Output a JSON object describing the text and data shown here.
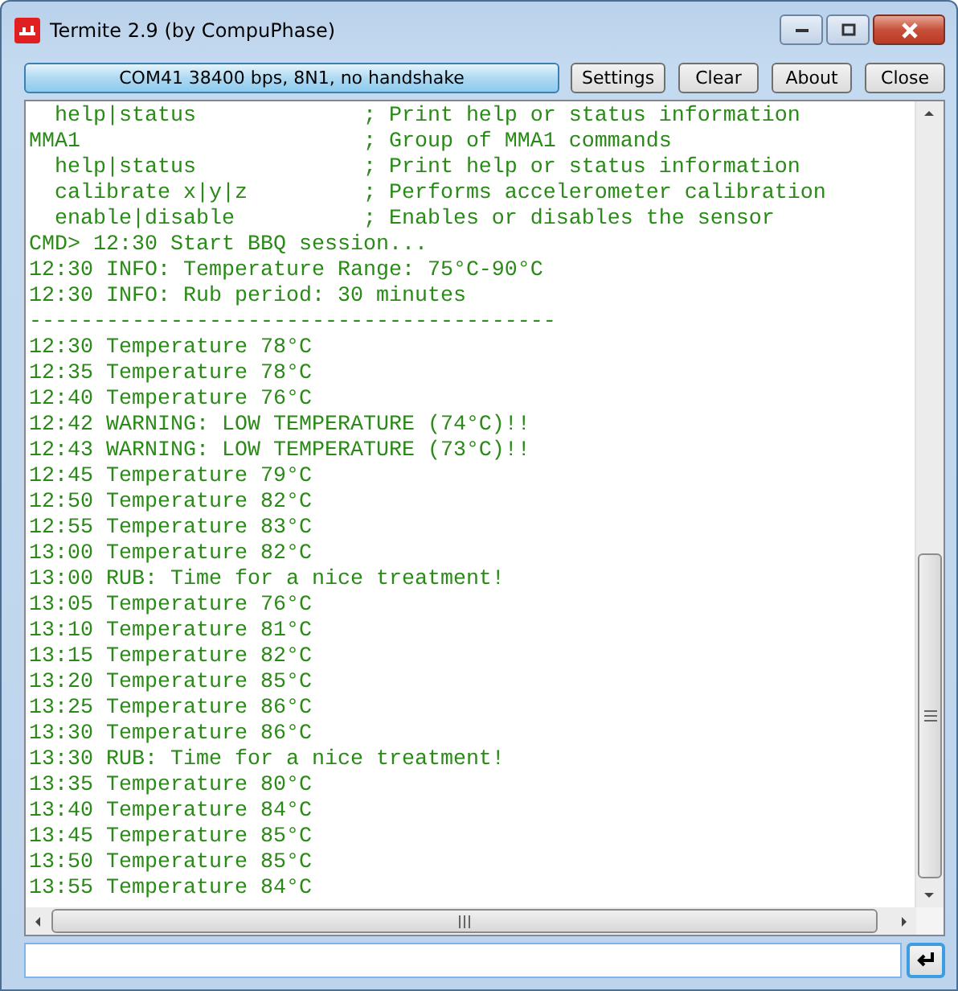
{
  "window": {
    "title": "Termite 2.9 (by CompuPhase)"
  },
  "toolbar": {
    "status": "COM41 38400 bps, 8N1, no handshake",
    "buttons": [
      "Settings",
      "Clear",
      "About",
      "Close"
    ]
  },
  "terminal": {
    "lines": [
      "  help|status             ; Print help or status information",
      "MMA1                      ; Group of MMA1 commands",
      "  help|status             ; Print help or status information",
      "  calibrate x|y|z         ; Performs accelerometer calibration",
      "  enable|disable          ; Enables or disables the sensor",
      "CMD> 12:30 Start BBQ session...",
      "12:30 INFO: Temperature Range: 75°C-90°C",
      "12:30 INFO: Rub period: 30 minutes",
      "-----------------------------------------",
      "12:30 Temperature 78°C",
      "12:35 Temperature 78°C",
      "12:40 Temperature 76°C",
      "12:42 WARNING: LOW TEMPERATURE (74°C)!!",
      "12:43 WARNING: LOW TEMPERATURE (73°C)!!",
      "12:45 Temperature 79°C",
      "12:50 Temperature 82°C",
      "12:55 Temperature 83°C",
      "13:00 Temperature 82°C",
      "13:00 RUB: Time for a nice treatment!",
      "13:05 Temperature 76°C",
      "13:10 Temperature 81°C",
      "13:15 Temperature 82°C",
      "13:20 Temperature 85°C",
      "13:25 Temperature 86°C",
      "13:30 Temperature 86°C",
      "13:30 RUB: Time for a nice treatment!",
      "13:35 Temperature 80°C",
      "13:40 Temperature 84°C",
      "13:45 Temperature 85°C",
      "13:50 Temperature 85°C",
      "13:55 Temperature 84°C"
    ]
  }
}
